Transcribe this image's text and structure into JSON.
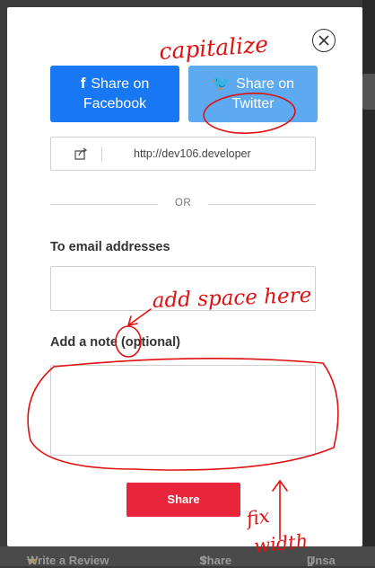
{
  "background": {
    "bottom_bar": {
      "write_review": "Write a Review",
      "share": "Share",
      "unsave": "Unsa"
    }
  },
  "modal": {
    "facebook_button": {
      "icon": "facebook-icon",
      "line1": "Share on",
      "line2": "Facebook",
      "color": "#1877f2"
    },
    "twitter_button": {
      "icon": "twitter-icon",
      "line1": "Share on",
      "line2": "Twitter",
      "color": "#5eaaf0"
    },
    "link": {
      "icon": "share-link-icon",
      "url": "http://dev106.developer"
    },
    "divider_text": "OR",
    "email_label": "To email addresses",
    "email_value": "",
    "note_label": "Add a note (optional)",
    "note_value": "",
    "submit_label": "Share",
    "submit_color": "#e8253a"
  },
  "annotations": {
    "color": "#e01010",
    "capitalize": "capitalize",
    "add_space": "add space here",
    "fix_width": "fix width"
  }
}
